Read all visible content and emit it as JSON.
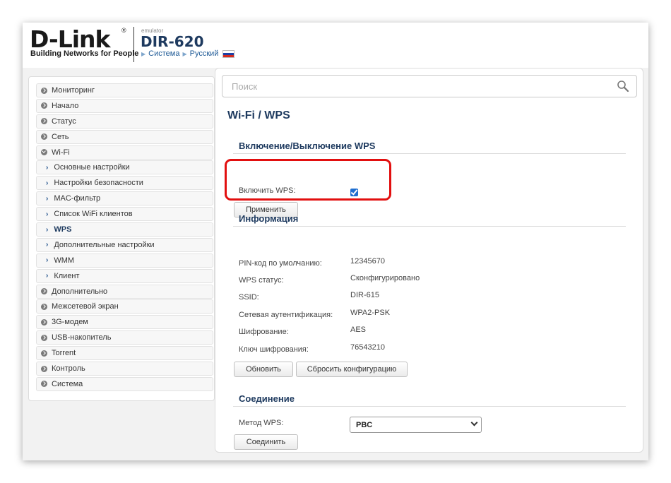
{
  "header": {
    "brand": "D-Link",
    "reg_mark": "®",
    "tagline": "Building Networks for People",
    "emulator": "emulator",
    "model": "DIR-620",
    "nav": [
      "Система",
      "Русский"
    ]
  },
  "sidebar": {
    "items": [
      {
        "label": "Мониторинг",
        "level": 0
      },
      {
        "label": "Начало",
        "level": 0
      },
      {
        "label": "Статус",
        "level": 0
      },
      {
        "label": "Сеть",
        "level": 0
      },
      {
        "label": "Wi-Fi",
        "level": 0,
        "expanded": true
      },
      {
        "label": "Основные настройки",
        "level": 1
      },
      {
        "label": "Настройки безопасности",
        "level": 1
      },
      {
        "label": "MAC-фильтр",
        "level": 1
      },
      {
        "label": "Список WiFi клиентов",
        "level": 1
      },
      {
        "label": "WPS",
        "level": 1,
        "active": true
      },
      {
        "label": "Дополнительные настройки",
        "level": 1
      },
      {
        "label": "WMM",
        "level": 1
      },
      {
        "label": "Клиент",
        "level": 1
      },
      {
        "label": "Дополнительно",
        "level": 0
      },
      {
        "label": "Межсетевой экран",
        "level": 0
      },
      {
        "label": "3G-модем",
        "level": 0
      },
      {
        "label": "USB-накопитель",
        "level": 0
      },
      {
        "label": "Torrent",
        "level": 0
      },
      {
        "label": "Контроль",
        "level": 0
      },
      {
        "label": "Система",
        "level": 0
      }
    ]
  },
  "search": {
    "placeholder": "Поиск"
  },
  "page": {
    "title": "Wi-Fi /  WPS",
    "enable_section": {
      "heading": "Включение/Выключение WPS",
      "enable_label": "Включить WPS:",
      "enabled": true,
      "apply_button": "Применить"
    },
    "info_section": {
      "heading": "Информация",
      "rows": [
        {
          "label": "PIN-код по умолчанию:",
          "value": "12345670"
        },
        {
          "label": "WPS статус:",
          "value": "Сконфигурировано"
        },
        {
          "label": "SSID:",
          "value": "DIR-615"
        },
        {
          "label": "Сетевая аутентификация:",
          "value": "WPA2-PSK"
        },
        {
          "label": "Шифрование:",
          "value": "AES"
        },
        {
          "label": "Ключ шифрования:",
          "value": "76543210"
        }
      ],
      "refresh_button": "Обновить",
      "reset_button": "Сбросить конфигурацию"
    },
    "connect_section": {
      "heading": "Соединение",
      "method_label": "Метод WPS:",
      "method_value": "PBC",
      "connect_button": "Соединить"
    }
  },
  "colors": {
    "accent": "#1e3a5f",
    "highlight": "#e20f0f",
    "checkbox": "#1f6fd0"
  }
}
